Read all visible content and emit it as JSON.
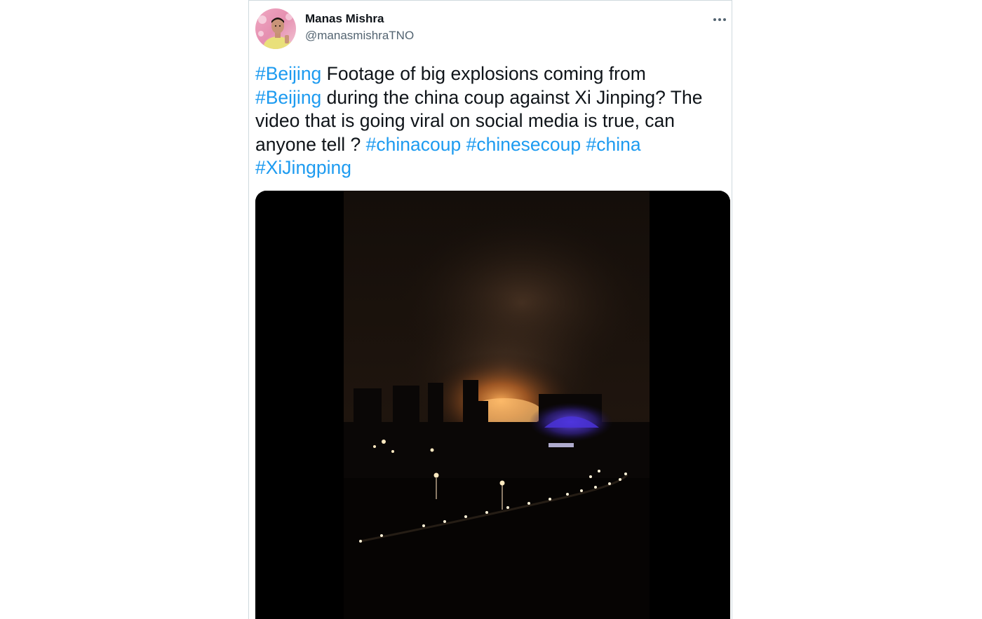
{
  "author": {
    "name": "Manas Mishra",
    "handle": "@manasmishraTNO"
  },
  "menu": {
    "more_icon": "more-horizontal-icon",
    "more_glyph": "···"
  },
  "tweet": {
    "lines": [
      [
        {
          "text": "#Beijing",
          "hashtag": true
        },
        {
          "text": " Footage of big explosions coming from",
          "hashtag": false
        }
      ],
      [
        {
          "text": "#Beijing",
          "hashtag": true
        },
        {
          "text": " during the china coup against Xi Jinping? The",
          "hashtag": false
        }
      ],
      [
        {
          "text": "video that is going viral on social media is true, can",
          "hashtag": false
        }
      ],
      [
        {
          "text": "anyone tell ? ",
          "hashtag": false
        },
        {
          "text": "#chinacoup",
          "hashtag": true
        },
        {
          "text": " ",
          "hashtag": false
        },
        {
          "text": "#chinesecoup",
          "hashtag": true
        },
        {
          "text": " ",
          "hashtag": false
        },
        {
          "text": "#china",
          "hashtag": true
        }
      ],
      [
        {
          "text": "#XiJingping",
          "hashtag": true
        }
      ]
    ]
  },
  "colors": {
    "hashtag": "#1d9bf0",
    "text": "#0f1419",
    "handle": "#536471",
    "border": "#cfd9de"
  }
}
